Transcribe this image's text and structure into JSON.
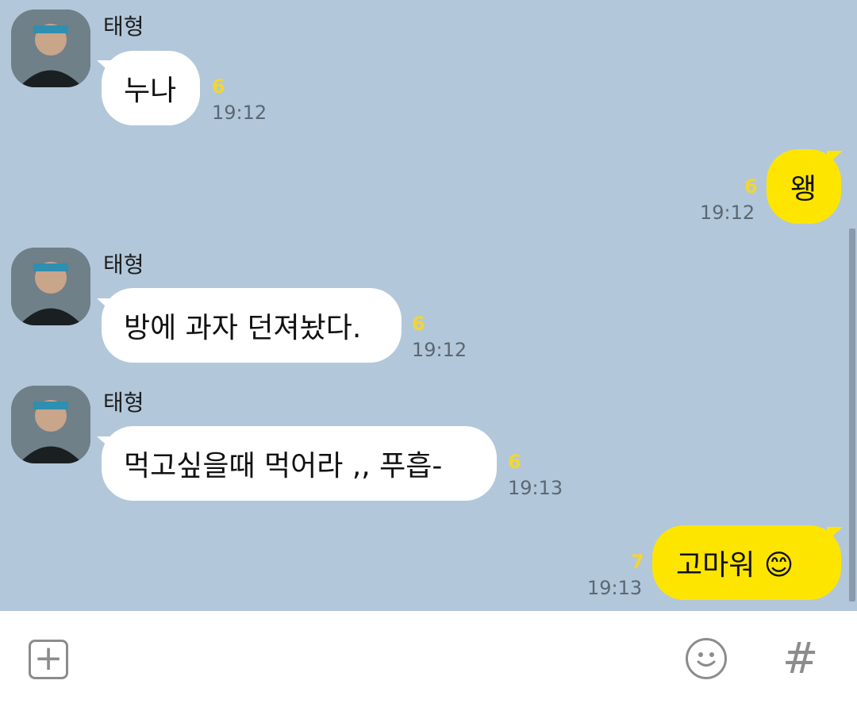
{
  "messages": [
    {
      "sender": "태형",
      "text": "누나",
      "unread": "6",
      "time": "19:12"
    },
    {
      "text": "왱",
      "unread": "6",
      "time": "19:12"
    },
    {
      "sender": "태형",
      "text": "방에 과자 던져놨다.",
      "unread": "6",
      "time": "19:12"
    },
    {
      "sender": "태형",
      "text": "먹고싶을때 먹어라 ,, 푸흡-",
      "unread": "6",
      "time": "19:13"
    },
    {
      "text": "고마워 😊",
      "unread": "7",
      "time": "19:13"
    }
  ],
  "input": {
    "plus_label": "+",
    "hash_label": "#"
  },
  "colors": {
    "background": "#b2c7da",
    "incoming": "#ffffff",
    "outgoing": "#fee500",
    "unread": "#f2d633"
  }
}
